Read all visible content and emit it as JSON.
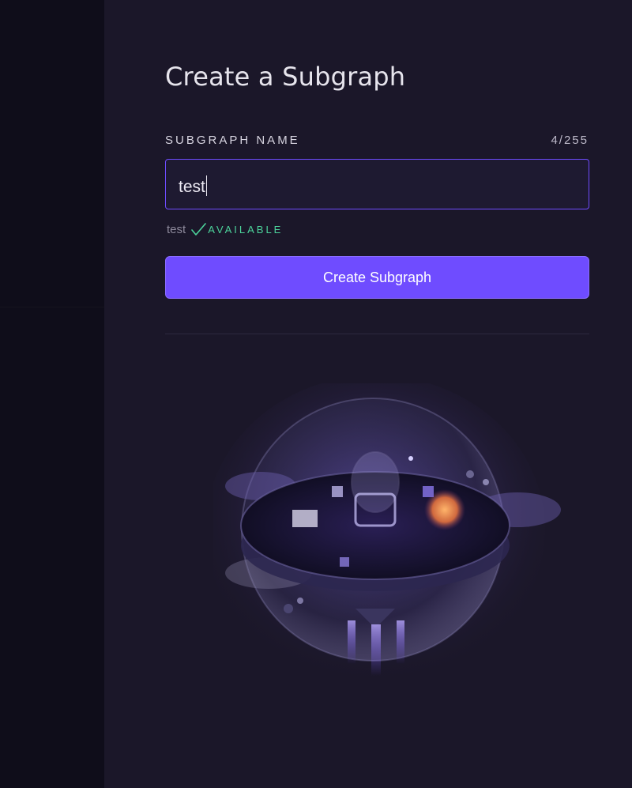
{
  "page": {
    "title": "Create a Subgraph"
  },
  "form": {
    "field_label": "SUBGRAPH NAME",
    "char_count": "4/255",
    "name_value": "test",
    "availability": {
      "name": "test",
      "status": "AVAILABLE",
      "icon": "check-icon",
      "color": "#4cd39b"
    },
    "submit_label": "Create Subgraph"
  },
  "colors": {
    "accent": "#6f4cff",
    "background": "#1b1729",
    "sidebar": "#0f0d1a"
  }
}
